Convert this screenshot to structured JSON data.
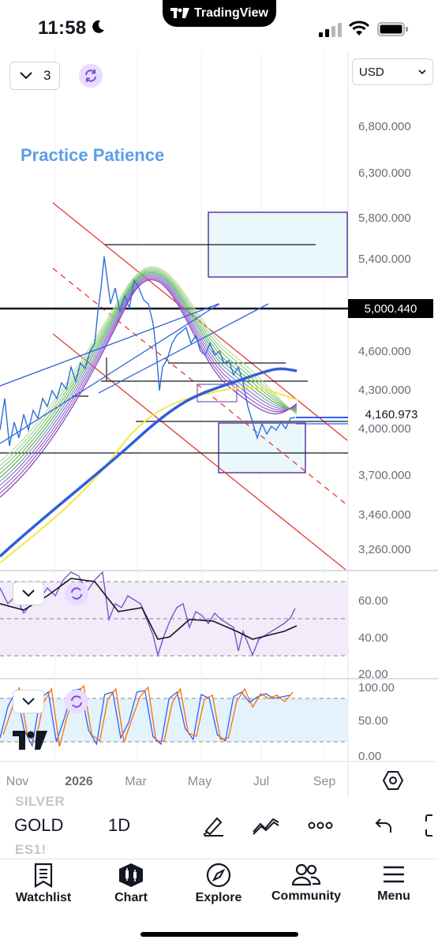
{
  "status_bar": {
    "time": "11:58",
    "app_pill": "TradingView"
  },
  "chart": {
    "interval_selector_value": "3",
    "currency": "USD",
    "annotation_text": "Practice Patience",
    "accent_purple": "#7b4bd6",
    "trendline_red": "#e53935",
    "channel_blue": "#2962ff"
  },
  "chart_data": {
    "type": "line",
    "price_axis": {
      "tick_labels": [
        "6,800.000",
        "6,300.000",
        "5,800.000",
        "5,400.000",
        "4,600.000",
        "4,300.000",
        "4,000.000",
        "3,700.000",
        "3,460.000",
        "3,260.000"
      ],
      "tick_values": [
        6800,
        6300,
        5800,
        5400,
        4600,
        4300,
        4000,
        3700,
        3460,
        3260
      ],
      "highlighted_label": "5,000.440",
      "highlighted_value": 5000.44,
      "last_price_label": "4,160.973",
      "last_price": 4160.973
    },
    "time_axis": {
      "labels": [
        "Nov",
        "2026",
        "Mar",
        "May",
        "Jul",
        "Sep"
      ]
    },
    "rsi_pane": {
      "tick_labels": [
        "60.00",
        "40.00",
        "20.00"
      ],
      "tick_values": [
        60,
        40,
        20
      ],
      "upper_band": 70,
      "lower_band": 30
    },
    "stoch_pane": {
      "tick_labels": [
        "100.00",
        "50.00",
        "0.00"
      ],
      "tick_values": [
        100,
        50,
        0
      ],
      "upper_band": 80,
      "lower_band": 20
    }
  },
  "symbol_bar": {
    "symbol": "GOLD",
    "ghost_above": "SILVER",
    "ghost_below": "ES1!",
    "interval": "1D"
  },
  "nav": {
    "items": [
      {
        "label": "Watchlist",
        "icon": "watchlist-icon"
      },
      {
        "label": "Chart",
        "icon": "chart-icon"
      },
      {
        "label": "Explore",
        "icon": "compass-icon"
      },
      {
        "label": "Community",
        "icon": "community-icon"
      },
      {
        "label": "Menu",
        "icon": "menu-icon"
      }
    ]
  }
}
